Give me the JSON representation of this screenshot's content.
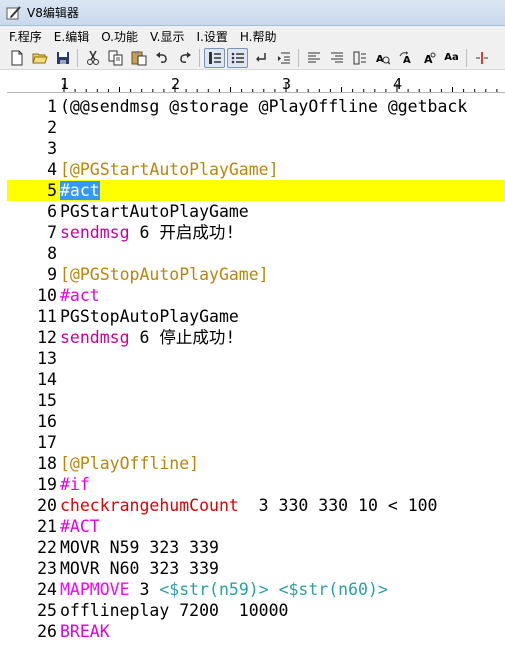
{
  "window": {
    "title": "V8编辑器"
  },
  "menu": [
    {
      "label": "F.程序"
    },
    {
      "label": "E.编辑"
    },
    {
      "label": "O.功能"
    },
    {
      "label": "V.显示"
    },
    {
      "label": "I.设置"
    },
    {
      "label": "H.帮助"
    }
  ],
  "toolbar": {
    "font_size_label": "Aa"
  },
  "ruler": {
    "numbers": [
      "1",
      "2",
      "3",
      "4"
    ]
  },
  "colors": {
    "current_line": "#ffff00",
    "selection": "#3399ff",
    "section": "#b8860b",
    "command": "#cc0099",
    "check": "#e00000"
  },
  "lines": [
    {
      "num": "1",
      "t1": "(@@sendmsg @storage @PlayOffline @getback"
    },
    {
      "num": "2",
      "t1": ""
    },
    {
      "num": "3",
      "t1": ""
    },
    {
      "num": "4",
      "t1": "[@PGStartAutoPlayGame]"
    },
    {
      "num": "5",
      "t1": "#act"
    },
    {
      "num": "6",
      "t1": "PGStartAutoPlayGame"
    },
    {
      "num": "7",
      "t1": "sendmsg",
      "t2": " 6 开启成功!"
    },
    {
      "num": "8",
      "t1": ""
    },
    {
      "num": "9",
      "t1": "[@PGStopAutoPlayGame]"
    },
    {
      "num": "10",
      "t1": "#act"
    },
    {
      "num": "11",
      "t1": "PGStopAutoPlayGame"
    },
    {
      "num": "12",
      "t1": "sendmsg",
      "t2": " 6 停止成功!"
    },
    {
      "num": "13",
      "t1": ""
    },
    {
      "num": "14",
      "t1": ""
    },
    {
      "num": "15",
      "t1": ""
    },
    {
      "num": "16",
      "t1": ""
    },
    {
      "num": "17",
      "t1": ""
    },
    {
      "num": "18",
      "t1": "[@PlayOffline]"
    },
    {
      "num": "19",
      "t1": "#if"
    },
    {
      "num": "20",
      "t1": "checkrangehumCount",
      "t2": "  3 330 330 10 < 100"
    },
    {
      "num": "21",
      "t1": "#ACT"
    },
    {
      "num": "22",
      "t1": "MOVR N59 323 339"
    },
    {
      "num": "23",
      "t1": "MOVR N60 323 339"
    },
    {
      "num": "24",
      "t1": "MAPMOVE",
      "t2": " 3 ",
      "t3": "<$str(n59)> <$str(n60)>"
    },
    {
      "num": "25",
      "t1": "offlineplay 7200  10000"
    },
    {
      "num": "26",
      "t1": "BREAK"
    }
  ]
}
